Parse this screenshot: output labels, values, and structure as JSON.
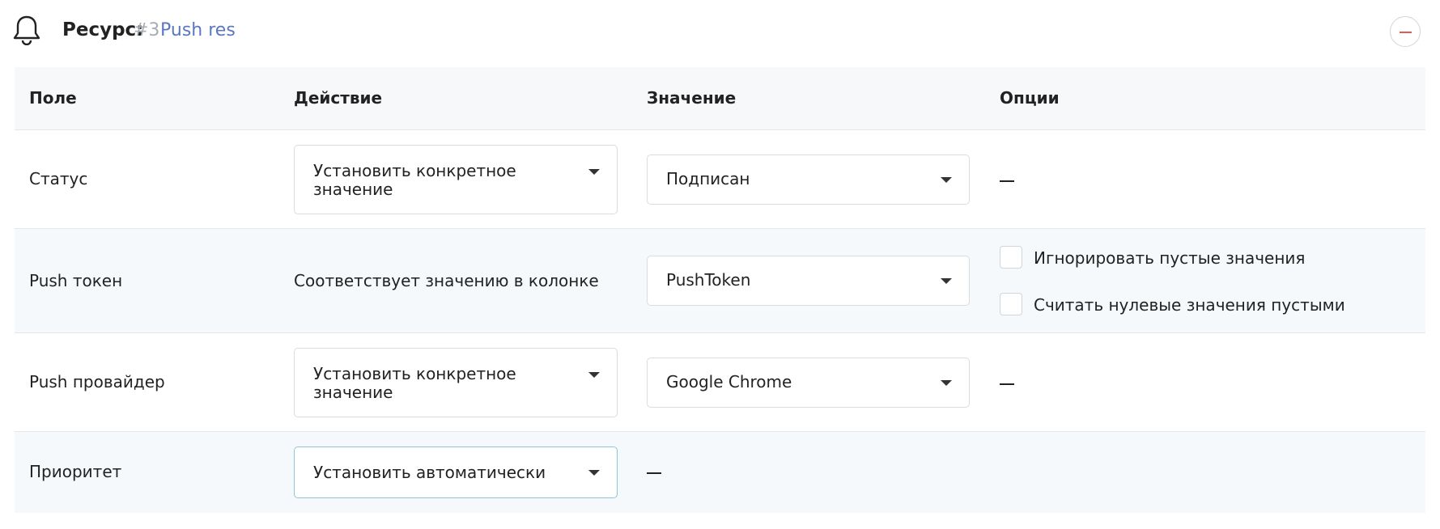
{
  "header": {
    "resource_label": "Ресурс:",
    "resource_number": "#3",
    "resource_name": "Push res",
    "bell_icon": "bell-icon",
    "collapse_icon": "minus-icon"
  },
  "colors": {
    "accent_link": "#5a77c4",
    "muted": "#a7adb5",
    "danger": "#e05a57",
    "focus_border": "#8cc6d8"
  },
  "table": {
    "columns": [
      "Поле",
      "Действие",
      "Значение",
      "Опции"
    ],
    "rows": [
      {
        "field": "Статус",
        "action": "Установить конкретное значение",
        "value": "Подписан",
        "options_dash": "—"
      },
      {
        "field": "Push токен",
        "action_text": "Соответствует значению в колонке",
        "value": "PushToken",
        "options": [
          {
            "label": "Игнорировать пустые значения",
            "checked": false
          },
          {
            "label": "Считать нулевые значения пустыми",
            "checked": false
          }
        ]
      },
      {
        "field": "Push провайдер",
        "action": "Установить конкретное значение",
        "value": "Google Chrome",
        "options_dash": "—"
      },
      {
        "field": "Приоритет",
        "action": "Установить автоматически",
        "value_dash": "—"
      }
    ]
  }
}
